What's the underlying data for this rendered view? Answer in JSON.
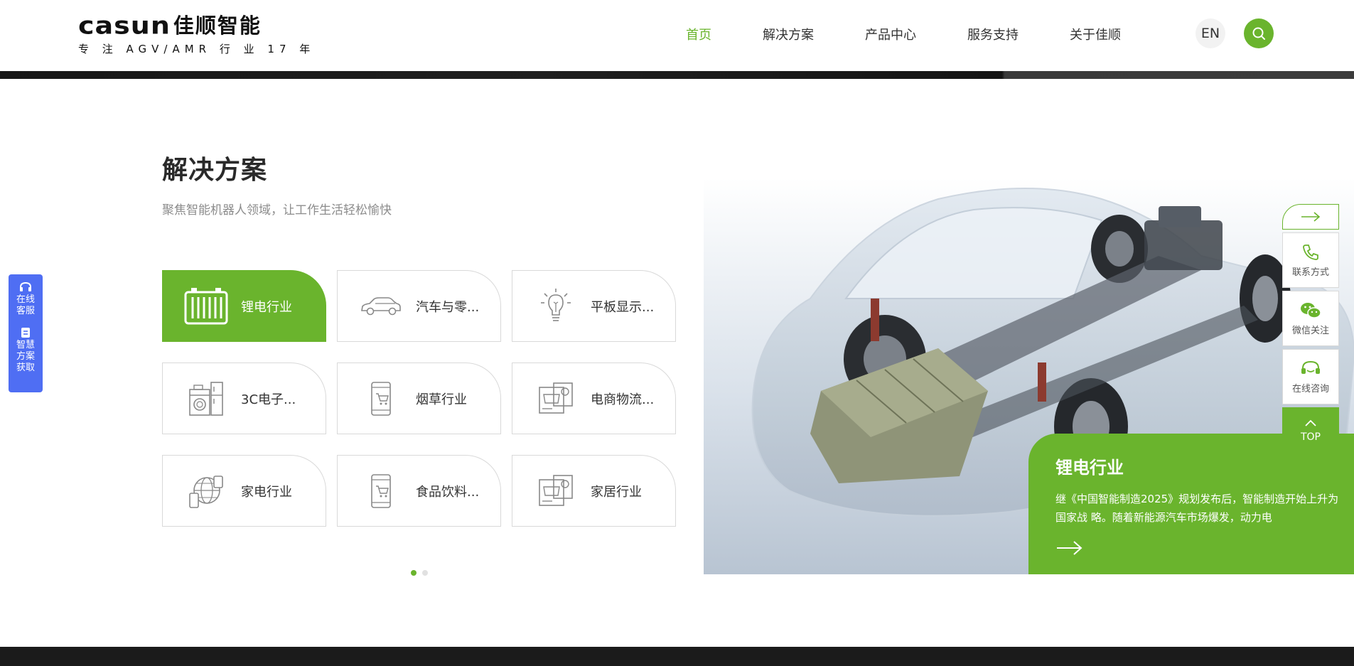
{
  "header": {
    "logo_brand": "casun",
    "logo_cn": "佳顺智能",
    "logo_tagline": "专 注 AGV/AMR 行 业 17 年",
    "nav": [
      {
        "label": "首页",
        "active": true
      },
      {
        "label": "解决方案",
        "active": false
      },
      {
        "label": "产品中心",
        "active": false
      },
      {
        "label": "服务支持",
        "active": false
      },
      {
        "label": "关于佳顺",
        "active": false
      }
    ],
    "lang_label": "EN",
    "search_icon": "search-icon"
  },
  "section": {
    "title": "解决方案",
    "subtitle": "聚焦智能机器人领域，让工作生活轻松愉快"
  },
  "industries": [
    {
      "label": "锂电行业",
      "icon": "battery-icon",
      "active": true
    },
    {
      "label": "汽车与零...",
      "icon": "car-icon",
      "active": false
    },
    {
      "label": "平板显示...",
      "icon": "lightbulb-icon",
      "active": false
    },
    {
      "label": "3C电子...",
      "icon": "appliance-icon",
      "active": false
    },
    {
      "label": "烟草行业",
      "icon": "phone-cart-icon",
      "active": false
    },
    {
      "label": "电商物流...",
      "icon": "store-icon",
      "active": false
    },
    {
      "label": "家电行业",
      "icon": "globe-devices-icon",
      "active": false
    },
    {
      "label": "食品饮料...",
      "icon": "phone-cart-icon",
      "active": false
    },
    {
      "label": "家居行业",
      "icon": "store-icon",
      "active": false
    }
  ],
  "pagination": {
    "pages": 2,
    "current": 1
  },
  "hero": {
    "title": "锂电行业",
    "text": "继《中国智能制造2025》规划发布后，智能制造开始上升为国家战 略。随着新能源汽车市场爆发，动力电"
  },
  "left_float": {
    "items": [
      {
        "label": "在线\n客服",
        "icon": "headset-icon"
      },
      {
        "label": "智慧\n方案\n获取",
        "icon": "document-icon"
      }
    ]
  },
  "right_float": {
    "items": [
      {
        "label": "联系方式",
        "icon": "phone-icon"
      },
      {
        "label": "微信关注",
        "icon": "wechat-icon"
      },
      {
        "label": "在线咨询",
        "icon": "headset-icon"
      }
    ],
    "top_label": "TOP"
  },
  "colors": {
    "accent": "#6ab42d",
    "float_blue": "#4f6ef3",
    "text_dark": "#333333",
    "text_muted": "#8c8c8c"
  }
}
